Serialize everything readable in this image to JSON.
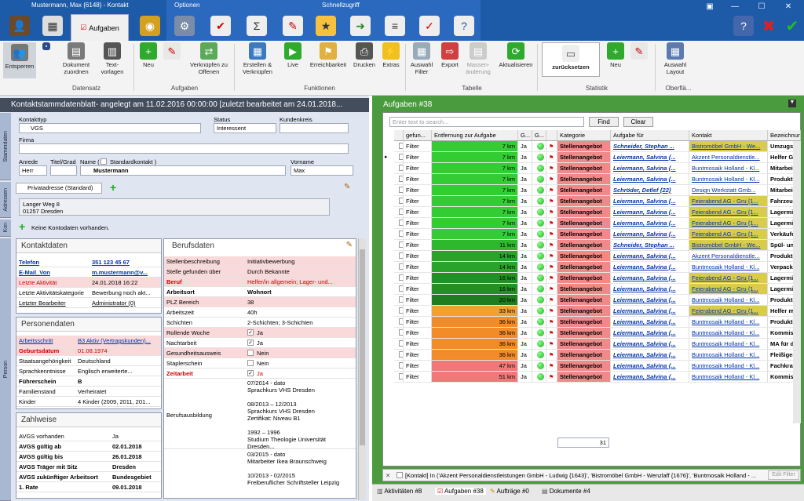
{
  "window": {
    "title": "Mustermann, Max {6148} - Kontakt",
    "options_label": "Optionen",
    "quickaccess_label": "Schnellzugriff",
    "tab_active": "Aufgaben"
  },
  "ribbon": {
    "entsperren": "Entsperren",
    "dokument_zuordnen": "Dokument zuordnen",
    "textvorlagen": "Text-vorlagen",
    "group_datensatz": "Datensatz",
    "neu": "Neu",
    "verknuepfen": "Verknüpfen zu Offenen",
    "group_aufgaben": "Aufgaben",
    "erstellen": "Erstellen & Verknüpfen",
    "live": "Live",
    "erreichbarkeit": "Erreichbarkeit",
    "drucken": "Drucken",
    "extras": "Extras",
    "group_funktionen": "Funktionen",
    "auswahl_filter": "Auswahl Filter",
    "export": "Export",
    "massenaenderung": "Massen-änderung",
    "aktualisieren": "Aktualisieren",
    "group_tabelle": "Tabelle",
    "zuruecksetzen": "zurücksetzen",
    "neu2": "Neu",
    "group_statistik": "Statistik",
    "auswahl_layout": "Auswahl Layout",
    "group_oberflaeche": "Oberflä..."
  },
  "left": {
    "header": "Kontaktstammdatenblatt- angelegt am 11.02.2016 00:00:00 [zuletzt bearbeitet am 24.01.2018...",
    "vtabs": [
      "Stammdaten",
      "Adressen",
      "Kon",
      "Person"
    ],
    "kontakttyp_label": "Kontakttyp",
    "kontakttyp_value": "VGS",
    "status_label": "Status",
    "status_value": "Interessent",
    "kundenkreis_label": "Kundenkreis",
    "firma_label": "Firma",
    "anrede_label": "Anrede",
    "anrede_value": "Herr",
    "titel_label": "Titel/Grad",
    "name_label": "Name (",
    "standardkontakt": "Standardkontakt )",
    "name_value": "Mustermann",
    "vorname_label": "Vorname",
    "vorname_value": "Max",
    "address_tab": "Privatadresse (Standard)",
    "address_line1": "Langer Weg 8",
    "address_line2": "01257 Dresden",
    "kontodaten_empty": "Keine Kontodaten vorhanden."
  },
  "kontaktdaten": {
    "title": "Kontaktdaten",
    "rows": [
      {
        "k": "Telefon",
        "v": "351 123 45 67",
        "style": "link bold"
      },
      {
        "k": "E-Mail_Von",
        "v": "m.mustermann@v...",
        "style": "link bold"
      },
      {
        "k": "Letzte Aktivität",
        "v": "24.01.2018 16:22",
        "style": "pinkk"
      },
      {
        "k": "Letzte Aktivitätskategorie",
        "v": "Bewerbung noch akt...",
        "style": ""
      },
      {
        "k": "Letzter Bearbeiter",
        "v": "Administrator (0)",
        "style": "underline"
      }
    ]
  },
  "personendaten": {
    "title": "Personendaten",
    "rows": [
      {
        "k": "Arbeitsschritt",
        "v": "B3 Aktiv (Vertragskunden)...",
        "style": "pinklink"
      },
      {
        "k": "Geburtsdatum",
        "v": "01.08.1974",
        "style": "pinkred"
      },
      {
        "k": "Staatsangehörigkeit",
        "v": "Deutschland",
        "style": ""
      },
      {
        "k": "Sprachkenntnisse",
        "v": "Englisch erweiterte...",
        "style": ""
      },
      {
        "k": "Führerschein",
        "v": "B",
        "style": "bold"
      },
      {
        "k": "Familienstand",
        "v": "Verheiratet",
        "style": ""
      },
      {
        "k": "Kinder",
        "v": "4 Kinder (2009, 2011, 201...",
        "style": ""
      }
    ]
  },
  "zahlweise": {
    "title": "Zahlweise",
    "rows": [
      {
        "k": "AVGS vorhanden",
        "v": "Ja",
        "style": ""
      },
      {
        "k": "AVGS gültig ab",
        "v": "02.01.2018",
        "style": "bold"
      },
      {
        "k": "AVGS gültig bis",
        "v": "26.01.2018",
        "style": "bold"
      },
      {
        "k": "AVGS Träger mit Sitz",
        "v": "Dresden",
        "style": "bold"
      },
      {
        "k": "AVGS zukünftiger Arbeitsort",
        "v": "Bundesgebiet",
        "style": "bold"
      },
      {
        "k": "1. Rate",
        "v": "09.01.2018",
        "style": "bold"
      }
    ]
  },
  "berufsdaten": {
    "title": "Berufsdaten",
    "rows": [
      {
        "k": "Stellenbeschreibung",
        "v": "Initiativbewerbung",
        "style": "pink"
      },
      {
        "k": "Stelle gefunden über",
        "v": "Durch Bekannte",
        "style": "pink"
      },
      {
        "k": "Beruf",
        "v": "Helfer/in allgemein; Lager- und...",
        "style": "pinkred"
      },
      {
        "k": "Arbeitsort",
        "v": "Wohnort",
        "style": "bold"
      },
      {
        "k": "PLZ Bereich",
        "v": "38",
        "style": "pink"
      },
      {
        "k": "Arbeitszeit",
        "v": "40h",
        "style": ""
      },
      {
        "k": "Schichten",
        "v": "2-Schichten; 3-Schichten",
        "style": ""
      },
      {
        "k": "Rollende Woche",
        "v": "Ja",
        "style": "pinkchk"
      },
      {
        "k": "Nachtarbeit",
        "v": "Ja",
        "style": "chk"
      },
      {
        "k": "Gesundheitsausweis",
        "v": "Nein",
        "style": "pinkchk0"
      },
      {
        "k": "Staplerschein",
        "v": "Nein",
        "style": "chk0"
      },
      {
        "k": "Zeitarbeit",
        "v": "Ja",
        "style": "redchk"
      }
    ],
    "ausbildung_label": "Berufsausbildung",
    "ausbildung": [
      "07/2014 - dato",
      "Sprachkurs VHS  Dresden",
      "",
      "08/2013 – 12/2013",
      "Sprachkurs VHS  Dresden",
      "Zertifikat: Niveau B1",
      "",
      "1992 – 1996",
      "Studium Theologie Universität",
      "Dresden..."
    ],
    "beruf_extra": [
      "03/2015 - dato",
      "Mitarbeiter Ikea  Braunschweig",
      "",
      "10/2013 - 02/2015",
      "Freiberuflicher Schriftsteller  Leipzig"
    ]
  },
  "right": {
    "header": "Aufgaben #38",
    "search_placeholder": "Enter text to search...",
    "find": "Find",
    "clear": "Clear",
    "columns": [
      "gefun...",
      "Entfernung zur Aufgabe",
      "G...",
      "G...",
      "Kategorie",
      "Aufgabe für",
      "Kontakt",
      "Bezeichnung"
    ],
    "rows": [
      {
        "f": "Filter",
        "d": "7 km",
        "g": "Ja",
        "kat": "Stellenangebot",
        "auf": "Schneider, Stephan ...",
        "kon": "Bistromöbel GmbH - We...",
        "bez": "Umzugsr",
        "c": "#33cc33",
        "kc": "#d8cc4a"
      },
      {
        "f": "Filter",
        "d": "7 km",
        "g": "Ja",
        "kat": "Stellenangebot",
        "auf": "Leiermann, Salvina {...",
        "kon": "Akzent Personaldienstle...",
        "bez": "Helfer G",
        "c": "#33cc33",
        "kc": ""
      },
      {
        "f": "Filter",
        "d": "7 km",
        "g": "Ja",
        "kat": "Stellenangebot",
        "auf": "Leiermann, Salvina {...",
        "kon": "Buntmosaik Holland - Kl...",
        "bez": "Mitarbei",
        "c": "#33cc33",
        "kc": ""
      },
      {
        "f": "Filter",
        "d": "7 km",
        "g": "Ja",
        "kat": "Stellenangebot",
        "auf": "Leiermann, Salvina {...",
        "kon": "Buntmosaik Holland - Kl...",
        "bez": "Produkti",
        "c": "#33cc33",
        "kc": ""
      },
      {
        "f": "Filter",
        "d": "7 km",
        "g": "Ja",
        "kat": "Stellenangebot",
        "auf": "Schröder, Detlef {22}",
        "kon": "Design Werkstatt Gmb...",
        "bez": "Mitarbei",
        "c": "#33cc33",
        "kc": ""
      },
      {
        "f": "Filter",
        "d": "7 km",
        "g": "Ja",
        "kat": "Stellenangebot",
        "auf": "Leiermann, Salvina {...",
        "kon": "Feierabend AG - Gru {1...",
        "bez": "Fahrzeug",
        "c": "#33cc33",
        "kc": "#d8cc4a"
      },
      {
        "f": "Filter",
        "d": "7 km",
        "g": "Ja",
        "kat": "Stellenangebot",
        "auf": "Leiermann, Salvina {...",
        "kon": "Feierabend AG - Gru {1...",
        "bez": "Lagermit",
        "c": "#33cc33",
        "kc": "#d8cc4a"
      },
      {
        "f": "Filter",
        "d": "7 km",
        "g": "Ja",
        "kat": "Stellenangebot",
        "auf": "Leiermann, Salvina {...",
        "kon": "Feierabend AG - Gru {1...",
        "bez": "Lagermit",
        "c": "#33cc33",
        "kc": "#d8cc4a"
      },
      {
        "f": "Filter",
        "d": "7 km",
        "g": "Ja",
        "kat": "Stellenangebot",
        "auf": "Leiermann, Salvina {...",
        "kon": "Feierabend AG - Gru {1...",
        "bez": "Verkäufe",
        "c": "#33cc33",
        "kc": "#d8cc4a"
      },
      {
        "f": "Filter",
        "d": "11 km",
        "g": "Ja",
        "kat": "Stellenangebot",
        "auf": "Schneider, Stephan ...",
        "kon": "Bistromöbel GmbH - We...",
        "bez": "Spül- un",
        "c": "#2eb82e",
        "kc": "#d8cc4a"
      },
      {
        "f": "Filter",
        "d": "14 km",
        "g": "Ja",
        "kat": "Stellenangebot",
        "auf": "Leiermann, Salvina {...",
        "kon": "Akzent Personaldienstle...",
        "bez": "Produkti",
        "c": "#29a329",
        "kc": ""
      },
      {
        "f": "Filter",
        "d": "14 km",
        "g": "Ja",
        "kat": "Stellenangebot",
        "auf": "Leiermann, Salvina {...",
        "kon": "Buntmosaik Holland - Kl...",
        "bez": "Verpacku",
        "c": "#29a329",
        "kc": ""
      },
      {
        "f": "Filter",
        "d": "16 km",
        "g": "Ja",
        "kat": "Stellenangebot",
        "auf": "Leiermann, Salvina {...",
        "kon": "Feierabend AG - Gru {1...",
        "bez": "Lagermit",
        "c": "#239023",
        "kc": "#d8cc4a"
      },
      {
        "f": "Filter",
        "d": "16 km",
        "g": "Ja",
        "kat": "Stellenangebot",
        "auf": "Leiermann, Salvina {...",
        "kon": "Feierabend AG - Gru {1...",
        "bez": "Lagermit",
        "c": "#239023",
        "kc": "#d8cc4a"
      },
      {
        "f": "Filter",
        "d": "20 km",
        "g": "Ja",
        "kat": "Stellenangebot",
        "auf": "Leiermann, Salvina {...",
        "kon": "Buntmosaik Holland - Kl...",
        "bez": "Produkti",
        "c": "#1e7d1e",
        "kc": ""
      },
      {
        "f": "Filter",
        "d": "33 km",
        "g": "Ja",
        "kat": "Stellenangebot",
        "auf": "Leiermann, Salvina {...",
        "kon": "Feierabend AG - Gru {1...",
        "bez": "Helfer m",
        "c": "#f2a030",
        "kc": "#d8cc4a"
      },
      {
        "f": "Filter",
        "d": "36 km",
        "g": "Ja",
        "kat": "Stellenangebot",
        "auf": "Leiermann, Salvina {...",
        "kon": "Buntmosaik Holland - Kl...",
        "bez": "Produkti",
        "c": "#f28c28",
        "kc": ""
      },
      {
        "f": "Filter",
        "d": "36 km",
        "g": "Ja",
        "kat": "Stellenangebot",
        "auf": "Leiermann, Salvina {...",
        "kon": "Buntmosaik Holland - Kl...",
        "bez": "Kommiss",
        "c": "#f28c28",
        "kc": ""
      },
      {
        "f": "Filter",
        "d": "36 km",
        "g": "Ja",
        "kat": "Stellenangebot",
        "auf": "Leiermann, Salvina {...",
        "kon": "Buntmosaik Holland - Kl...",
        "bez": "MA für d",
        "c": "#f28c28",
        "kc": ""
      },
      {
        "f": "Filter",
        "d": "36 km",
        "g": "Ja",
        "kat": "Stellenangebot",
        "auf": "Leiermann, Salvina {...",
        "kon": "Buntmosaik Holland - Kl...",
        "bez": "Fleißiger",
        "c": "#f28c28",
        "kc": ""
      },
      {
        "f": "Filter",
        "d": "47 km",
        "g": "Ja",
        "kat": "Stellenangebot",
        "auf": "Leiermann, Salvina {...",
        "kon": "Buntmosaik Holland - Kl...",
        "bez": "Fachkraf",
        "c": "#f07878",
        "kc": ""
      },
      {
        "f": "Filter",
        "d": "51 km",
        "g": "Ja",
        "kat": "Stellenangebot",
        "auf": "Leiermann, Salvina {...",
        "kon": "Buntmosaik Holland - Kl...",
        "bez": "Kommissi",
        "c": "#f07878",
        "kc": ""
      }
    ],
    "count": "31",
    "filter_text": "[Kontakt] In ('Akzent Personaldienstleistungen GmbH - Ludwig {1643}', 'Bistromöbel GmbH - Wenzlaff {1676}', 'Buntmosaik Holland - ...",
    "edit_filter": "Edit Filter"
  },
  "bottom_tabs": [
    "Aktivitäten #8",
    "Aufgaben #38",
    "Aufträge #0",
    "Dokumente #4"
  ],
  "colors": {
    "titlebar": "#1d5aa8",
    "right_bg": "#4a9b3e",
    "kategorie": "#f08a8a"
  }
}
